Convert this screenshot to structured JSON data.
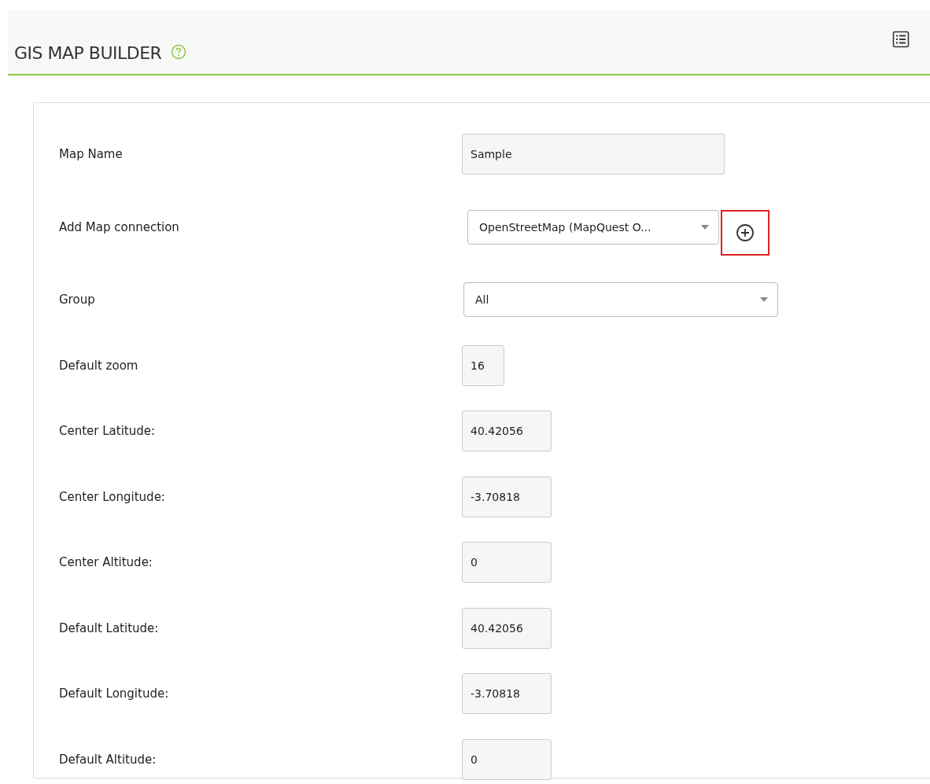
{
  "header": {
    "title": "GIS MAP BUILDER"
  },
  "fields": [
    {
      "label": "Map Name",
      "kind": "text",
      "value": "Sample"
    },
    {
      "label": "Add Map connection",
      "kind": "select-add",
      "value": "OpenStreetMap (MapQuest O...",
      "add_highlighted": true
    },
    {
      "label": "Group",
      "kind": "select",
      "value": "All"
    },
    {
      "label": "Default zoom",
      "kind": "small",
      "value": "16"
    },
    {
      "label": "Center Latitude:",
      "kind": "number",
      "value": "40.42056"
    },
    {
      "label": "Center Longitude:",
      "kind": "number",
      "value": "-3.70818"
    },
    {
      "label": "Center Altitude:",
      "kind": "number",
      "value": "0"
    },
    {
      "label": "Default Latitude:",
      "kind": "number",
      "value": "40.42056"
    },
    {
      "label": "Default Longitude:",
      "kind": "number",
      "value": "-3.70818"
    },
    {
      "label": "Default Altitude:",
      "kind": "number",
      "value": "0"
    }
  ]
}
